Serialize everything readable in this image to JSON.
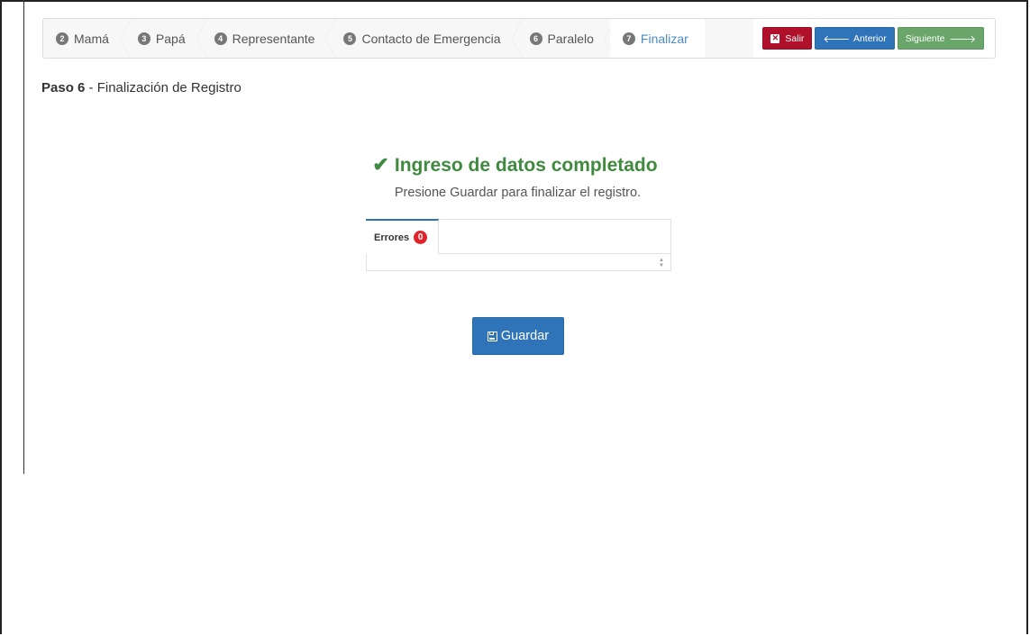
{
  "wizard": {
    "steps": [
      {
        "num": "2",
        "label": "Mamá"
      },
      {
        "num": "3",
        "label": "Papá"
      },
      {
        "num": "4",
        "label": "Representante"
      },
      {
        "num": "5",
        "label": "Contacto de Emergencia"
      },
      {
        "num": "6",
        "label": "Paralelo"
      },
      {
        "num": "7",
        "label": "Finalizar",
        "active": true
      }
    ],
    "buttons": {
      "exit": "Salir",
      "previous": "Anterior",
      "next": "Siguiente"
    }
  },
  "page": {
    "step_bold": "Paso 6",
    "step_rest": " - Finalización de Registro"
  },
  "status": {
    "title": "Ingreso de datos completado",
    "subtitle": "Presione Guardar para finalizar el registro."
  },
  "errors": {
    "tab_label": "Errores",
    "count": "0"
  },
  "actions": {
    "save_label": "Guardar"
  },
  "colors": {
    "success": "#3f8a3f",
    "primary": "#2f73b8",
    "danger": "#b0102a",
    "next": "#6aa56a",
    "badge": "#e0242c"
  },
  "icons": {
    "check": "check-icon",
    "exit": "close-box-icon",
    "previous": "arrow-left-icon",
    "next": "arrow-right-icon",
    "save": "floppy-disk-icon"
  }
}
